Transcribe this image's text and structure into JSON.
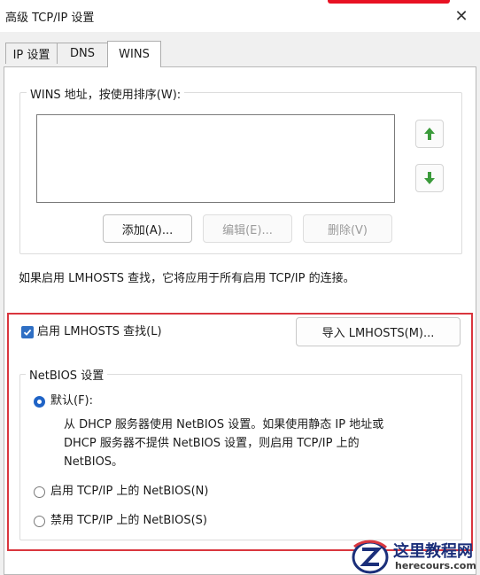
{
  "window": {
    "title": "高级 TCP/IP 设置",
    "close_glyph": "✕"
  },
  "tabs": [
    {
      "label": "IP 设置",
      "active": false
    },
    {
      "label": "DNS",
      "active": false
    },
    {
      "label": "WINS",
      "active": true
    }
  ],
  "wins": {
    "group_label": "WINS 地址，按使用排序(W):",
    "addresses": [],
    "buttons": {
      "add": "添加(A)...",
      "edit": "编辑(E)...",
      "remove": "删除(V)"
    },
    "move_up_icon": "arrow-up",
    "move_down_icon": "arrow-down",
    "arrow_color": "#3a9a3a"
  },
  "lmhosts": {
    "note": "如果启用 LMHOSTS 查找，它将应用于所有启用 TCP/IP 的连接。",
    "enable_label": "启用 LMHOSTS 查找(L)",
    "enable_checked": true,
    "import_button": "导入 LMHOSTS(M)..."
  },
  "netbios": {
    "group_label": "NetBIOS 设置",
    "options": [
      {
        "label": "默认(F):",
        "checked": true
      },
      {
        "label": "启用 TCP/IP 上的 NetBIOS(N)",
        "checked": false
      },
      {
        "label": "禁用 TCP/IP 上的 NetBIOS(S)",
        "checked": false
      }
    ],
    "default_description": [
      "从 DHCP 服务器使用 NetBIOS 设置。如果使用静态 IP 地址或",
      "DHCP 服务器不提供 NetBIOS 设置，则启用 TCP/IP 上的",
      "NetBIOS。"
    ]
  },
  "colors": {
    "highlight_border": "#d9363e",
    "accent_blue": "#1f63c6"
  },
  "watermark": {
    "brand": "这里教程网",
    "domain": "herecours.com"
  }
}
